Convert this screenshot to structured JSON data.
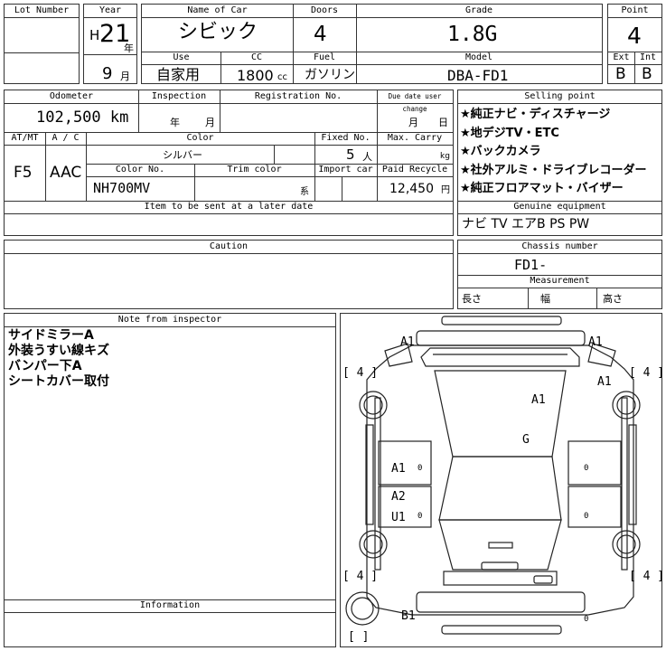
{
  "header": {
    "lot_number_label": "Lot Number",
    "year_label": "Year",
    "year_era": "H",
    "year_value": "21",
    "year_unit": "年",
    "month_value": "9",
    "month_unit": "月",
    "name_of_car_label": "Name of Car",
    "name_of_car": "シビック",
    "doors_label": "Doors",
    "doors": "4",
    "grade_label": "Grade",
    "grade": "1.8G",
    "point_label": "Point",
    "point": "4",
    "use_label": "Use",
    "use": "自家用",
    "cc_label": "CC",
    "cc": "1800",
    "cc_unit": "cc",
    "fuel_label": "Fuel",
    "fuel": "ガソリン",
    "model_label": "Model",
    "model": "DBA-FD1",
    "ext_label": "Ext",
    "int_label": "Int",
    "ext_grade": "B",
    "int_grade": "B"
  },
  "details": {
    "odometer_label": "Odometer",
    "odometer": "102,500 km",
    "inspection_label": "Inspection",
    "inspection_year_unit": "年",
    "inspection_month_unit": "月",
    "registration_label": "Registration No.",
    "due_date_label": "Due date user change",
    "due_month_unit": "月",
    "due_day_unit": "日",
    "atmt_label": "AT/MT",
    "atmt": "F5",
    "ac_label": "A / C",
    "ac": "AAC",
    "color_label": "Color",
    "color": "シルバー",
    "fixed_no_label": "Fixed No.",
    "fixed_no": "5",
    "fixed_no_unit": "人",
    "max_carry_label": "Max. Carry",
    "max_carry_unit": "kg",
    "color_no_label": "Color No.",
    "color_no": "NH700MV",
    "trim_color_label": "Trim color",
    "trim_suffix": "系",
    "import_car_label": "Import car",
    "paid_recycle_label": "Paid Recycle",
    "paid_recycle": "12,450",
    "paid_recycle_unit": "円",
    "later_date_label": "Item to be sent at a later date"
  },
  "selling_point": {
    "label": "Selling point",
    "items": [
      "★純正ナビ・ディスチャージ",
      "★地デジTV・ETC",
      "★バックカメラ",
      "★社外アルミ・ドライブレコーダー",
      "★純正フロアマット・バイザー"
    ]
  },
  "genuine_equipment": {
    "label": "Genuine equipment",
    "value": "ナビ TV エアB PS PW"
  },
  "caution": {
    "label": "Caution"
  },
  "chassis": {
    "label": "Chassis number",
    "value": "FD1-"
  },
  "measurement": {
    "label": "Measurement",
    "length": "長さ",
    "width": "幅",
    "height": "高さ"
  },
  "inspector_notes": {
    "label": "Note from inspector",
    "lines": [
      "サイドミラーA",
      "外装うすい線キズ",
      "バンパー下A",
      "シートカバー取付"
    ]
  },
  "information": {
    "label": "Information"
  },
  "diagram": {
    "marks": {
      "mirror_left": "A1",
      "mirror_right": "A1",
      "fender_right": "A1",
      "hood": "A1",
      "windshield": "G",
      "door_left_front": "A1",
      "door_left_rear_1": "A2",
      "door_left_rear_2": "U1",
      "rear_bumper": "B1"
    },
    "tyre_labels": [
      "[ 4 ]",
      "[ 4 ]",
      "[ 4 ]",
      "[ 4 ]",
      "[   ]"
    ],
    "zeros": [
      "0",
      "0",
      "0",
      "0",
      "0"
    ]
  }
}
